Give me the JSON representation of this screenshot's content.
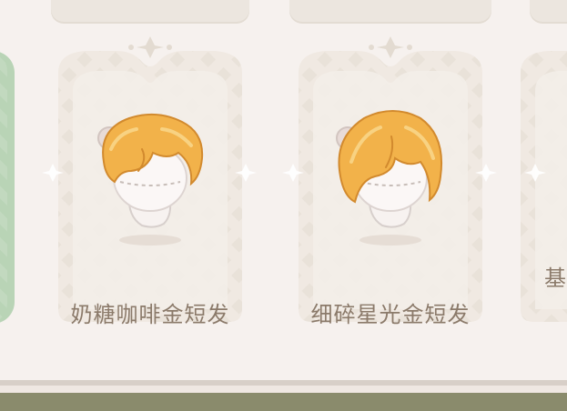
{
  "items": [
    {
      "id": "item-1",
      "label": "奶糖咖啡金短发"
    },
    {
      "id": "item-2",
      "label": "细碎星光金短发"
    },
    {
      "id": "item-3",
      "label": "基"
    }
  ],
  "colors": {
    "background": "#f6f1ee",
    "card_fill": "#f1ebe5",
    "card_pattern": "#e8e1d8",
    "label": "#8b7a6a",
    "hair": "#f2b24a",
    "side_card": "#b9d4b6"
  }
}
